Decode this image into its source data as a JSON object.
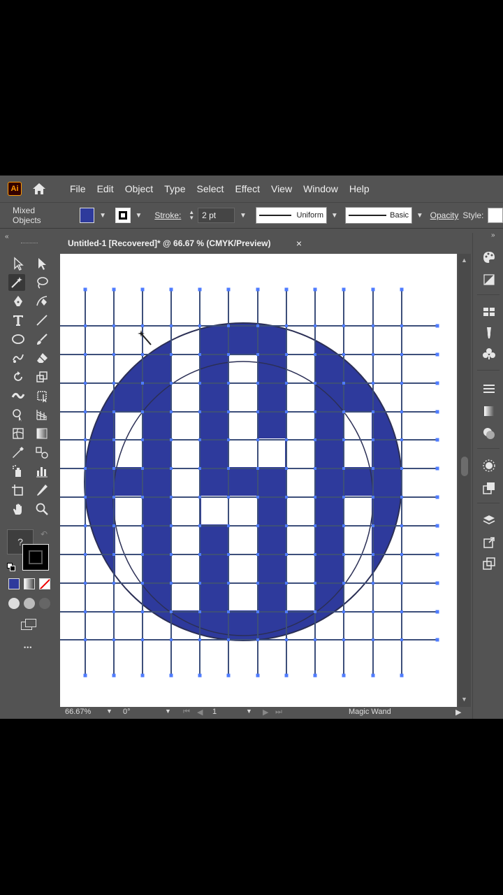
{
  "menubar": {
    "app_logo": "Ai",
    "items": [
      "File",
      "Edit",
      "Object",
      "Type",
      "Select",
      "Effect",
      "View",
      "Window",
      "Help"
    ]
  },
  "controlbar": {
    "selection_label": "Mixed Objects",
    "fill_color": "#2e3a9c",
    "stroke_label": "Stroke:",
    "stroke_weight": "2 pt",
    "profile_label": "Uniform",
    "brush_label": "Basic",
    "opacity_label": "Opacity",
    "style_label": "Style:"
  },
  "document": {
    "tab_title": "Untitled-1 [Recovered]* @ 66.67 % (CMYK/Preview)",
    "close_glyph": "×"
  },
  "toolbar": {
    "collapse_glyph": "«",
    "question_glyph": "?",
    "more_glyph": "•••"
  },
  "rightdock": {
    "collapse_glyph": "»"
  },
  "statusbar": {
    "zoom": "66.67%",
    "rotation": "0°",
    "artboard": "1",
    "current_tool": "Magic Wand"
  },
  "colors": {
    "ui_gray": "#535353",
    "artwork_fill": "#2e3a9c",
    "grid_line": "#3d4f7a",
    "anchor": "#4f7cff"
  },
  "artwork": {
    "monogram": "ASH"
  }
}
